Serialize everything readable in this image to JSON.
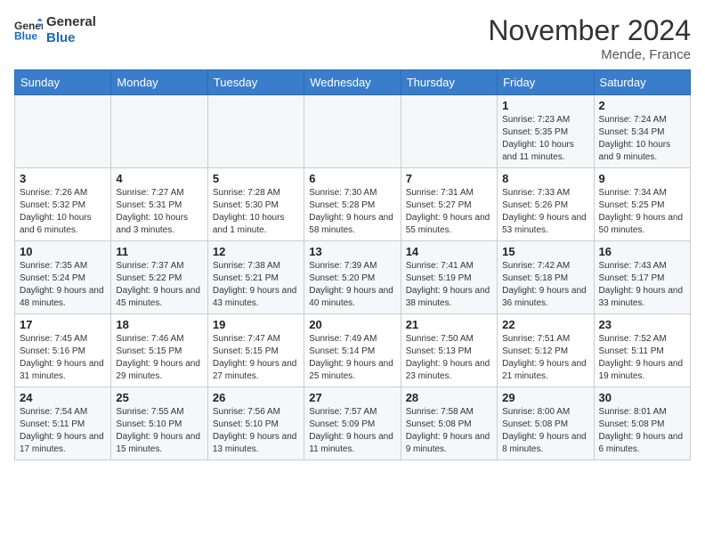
{
  "header": {
    "logo_line1": "General",
    "logo_line2": "Blue",
    "month": "November 2024",
    "location": "Mende, France"
  },
  "days_of_week": [
    "Sunday",
    "Monday",
    "Tuesday",
    "Wednesday",
    "Thursday",
    "Friday",
    "Saturday"
  ],
  "weeks": [
    [
      {
        "day": "",
        "info": ""
      },
      {
        "day": "",
        "info": ""
      },
      {
        "day": "",
        "info": ""
      },
      {
        "day": "",
        "info": ""
      },
      {
        "day": "",
        "info": ""
      },
      {
        "day": "1",
        "info": "Sunrise: 7:23 AM\nSunset: 5:35 PM\nDaylight: 10 hours and 11 minutes."
      },
      {
        "day": "2",
        "info": "Sunrise: 7:24 AM\nSunset: 5:34 PM\nDaylight: 10 hours and 9 minutes."
      }
    ],
    [
      {
        "day": "3",
        "info": "Sunrise: 7:26 AM\nSunset: 5:32 PM\nDaylight: 10 hours and 6 minutes."
      },
      {
        "day": "4",
        "info": "Sunrise: 7:27 AM\nSunset: 5:31 PM\nDaylight: 10 hours and 3 minutes."
      },
      {
        "day": "5",
        "info": "Sunrise: 7:28 AM\nSunset: 5:30 PM\nDaylight: 10 hours and 1 minute."
      },
      {
        "day": "6",
        "info": "Sunrise: 7:30 AM\nSunset: 5:28 PM\nDaylight: 9 hours and 58 minutes."
      },
      {
        "day": "7",
        "info": "Sunrise: 7:31 AM\nSunset: 5:27 PM\nDaylight: 9 hours and 55 minutes."
      },
      {
        "day": "8",
        "info": "Sunrise: 7:33 AM\nSunset: 5:26 PM\nDaylight: 9 hours and 53 minutes."
      },
      {
        "day": "9",
        "info": "Sunrise: 7:34 AM\nSunset: 5:25 PM\nDaylight: 9 hours and 50 minutes."
      }
    ],
    [
      {
        "day": "10",
        "info": "Sunrise: 7:35 AM\nSunset: 5:24 PM\nDaylight: 9 hours and 48 minutes."
      },
      {
        "day": "11",
        "info": "Sunrise: 7:37 AM\nSunset: 5:22 PM\nDaylight: 9 hours and 45 minutes."
      },
      {
        "day": "12",
        "info": "Sunrise: 7:38 AM\nSunset: 5:21 PM\nDaylight: 9 hours and 43 minutes."
      },
      {
        "day": "13",
        "info": "Sunrise: 7:39 AM\nSunset: 5:20 PM\nDaylight: 9 hours and 40 minutes."
      },
      {
        "day": "14",
        "info": "Sunrise: 7:41 AM\nSunset: 5:19 PM\nDaylight: 9 hours and 38 minutes."
      },
      {
        "day": "15",
        "info": "Sunrise: 7:42 AM\nSunset: 5:18 PM\nDaylight: 9 hours and 36 minutes."
      },
      {
        "day": "16",
        "info": "Sunrise: 7:43 AM\nSunset: 5:17 PM\nDaylight: 9 hours and 33 minutes."
      }
    ],
    [
      {
        "day": "17",
        "info": "Sunrise: 7:45 AM\nSunset: 5:16 PM\nDaylight: 9 hours and 31 minutes."
      },
      {
        "day": "18",
        "info": "Sunrise: 7:46 AM\nSunset: 5:15 PM\nDaylight: 9 hours and 29 minutes."
      },
      {
        "day": "19",
        "info": "Sunrise: 7:47 AM\nSunset: 5:15 PM\nDaylight: 9 hours and 27 minutes."
      },
      {
        "day": "20",
        "info": "Sunrise: 7:49 AM\nSunset: 5:14 PM\nDaylight: 9 hours and 25 minutes."
      },
      {
        "day": "21",
        "info": "Sunrise: 7:50 AM\nSunset: 5:13 PM\nDaylight: 9 hours and 23 minutes."
      },
      {
        "day": "22",
        "info": "Sunrise: 7:51 AM\nSunset: 5:12 PM\nDaylight: 9 hours and 21 minutes."
      },
      {
        "day": "23",
        "info": "Sunrise: 7:52 AM\nSunset: 5:11 PM\nDaylight: 9 hours and 19 minutes."
      }
    ],
    [
      {
        "day": "24",
        "info": "Sunrise: 7:54 AM\nSunset: 5:11 PM\nDaylight: 9 hours and 17 minutes."
      },
      {
        "day": "25",
        "info": "Sunrise: 7:55 AM\nSunset: 5:10 PM\nDaylight: 9 hours and 15 minutes."
      },
      {
        "day": "26",
        "info": "Sunrise: 7:56 AM\nSunset: 5:10 PM\nDaylight: 9 hours and 13 minutes."
      },
      {
        "day": "27",
        "info": "Sunrise: 7:57 AM\nSunset: 5:09 PM\nDaylight: 9 hours and 11 minutes."
      },
      {
        "day": "28",
        "info": "Sunrise: 7:58 AM\nSunset: 5:08 PM\nDaylight: 9 hours and 9 minutes."
      },
      {
        "day": "29",
        "info": "Sunrise: 8:00 AM\nSunset: 5:08 PM\nDaylight: 9 hours and 8 minutes."
      },
      {
        "day": "30",
        "info": "Sunrise: 8:01 AM\nSunset: 5:08 PM\nDaylight: 9 hours and 6 minutes."
      }
    ]
  ]
}
